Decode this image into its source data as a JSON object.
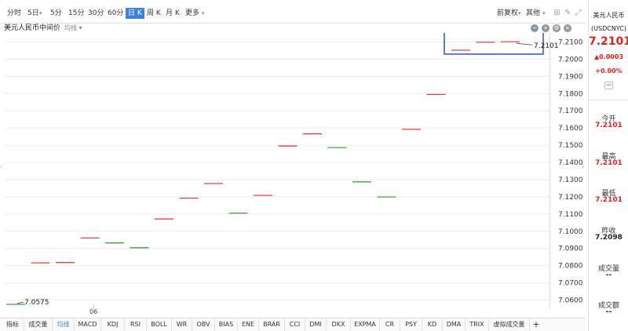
{
  "toolbar": {
    "periods": [
      "分时",
      "5日",
      "5分",
      "15分",
      "30分",
      "60分",
      "日 K",
      "周 K",
      "月 K",
      "更多"
    ],
    "active_period": "日 K",
    "adjust_label": "前复权",
    "other_label": "其他",
    "icons": [
      "grid-icon",
      "draw-icon",
      "expand-icon"
    ]
  },
  "chart_header": {
    "title": "美元人民币中间价",
    "avg_label": "均线",
    "controls": [
      "zoom-out-icon",
      "zoom-in-icon",
      "settings-icon",
      "close-icon"
    ]
  },
  "chart_data": {
    "type": "candlestick",
    "title": "美元人民币中间价",
    "y_ticks": [
      "7.2100",
      "7.2000",
      "7.1900",
      "7.1800",
      "7.1700",
      "7.1600",
      "7.1500",
      "7.1400",
      "7.1300",
      "7.1200",
      "7.1100",
      "7.1000",
      "7.0900",
      "7.0800",
      "7.0700",
      "7.0600"
    ],
    "ylim": [
      7.0575,
      7.2143
    ],
    "x_label_tick": "06",
    "max_annotation": "7.2101",
    "min_annotation": "7.0575",
    "bars": [
      {
        "value": 7.0575,
        "color": "green"
      },
      {
        "value": 7.0816,
        "color": "red"
      },
      {
        "value": 7.0818,
        "color": "red"
      },
      {
        "value": 7.096,
        "color": "red"
      },
      {
        "value": 7.0932,
        "color": "green"
      },
      {
        "value": 7.0904,
        "color": "green"
      },
      {
        "value": 7.1071,
        "color": "red"
      },
      {
        "value": 7.1192,
        "color": "red"
      },
      {
        "value": 7.1277,
        "color": "red"
      },
      {
        "value": 7.1105,
        "color": "green"
      },
      {
        "value": 7.1208,
        "color": "red"
      },
      {
        "value": 7.1495,
        "color": "red"
      },
      {
        "value": 7.1566,
        "color": "red"
      },
      {
        "value": 7.1486,
        "color": "green"
      },
      {
        "value": 7.1287,
        "color": "green"
      },
      {
        "value": 7.1199,
        "color": "green"
      },
      {
        "value": 7.1592,
        "color": "red"
      },
      {
        "value": 7.1795,
        "color": "red"
      },
      {
        "value": 7.2052,
        "color": "red"
      },
      {
        "value": 7.2098,
        "color": "red"
      },
      {
        "value": 7.2101,
        "color": "red"
      }
    ],
    "highlight_box": {
      "from_index": 18,
      "to_index": 20
    },
    "colors": {
      "red": "#e8413f",
      "green": "#3aa53a",
      "grid": "#ececec",
      "box": "#2a52c9"
    }
  },
  "indicators": {
    "tabs": [
      "指标",
      "成交量",
      "均线",
      "MACD",
      "KDJ",
      "RSI",
      "BOLL",
      "WR",
      "OBV",
      "BIAS",
      "ENE",
      "BRAR",
      "CCI",
      "DMI",
      "DKX",
      "EXPMA",
      "CR",
      "PSY",
      "KD",
      "DMA",
      "TRIX",
      "虚拟成交量",
      "+"
    ],
    "active": "均线"
  },
  "panel": {
    "name": "美元人民币",
    "code": "(USDCNYC)",
    "price": "7.2101",
    "change": "▲0.0003",
    "change_pct": "+0.00%",
    "minus": "−",
    "stats": [
      {
        "label": "今开",
        "value": "7.2101",
        "tone": "red"
      },
      {
        "label": "最高",
        "value": "7.2101",
        "tone": "red"
      },
      {
        "label": "最低",
        "value": "7.2101",
        "tone": "red"
      },
      {
        "label": "昨收",
        "value": "7.2098",
        "tone": "dark"
      },
      {
        "label": "成交量",
        "value": "--",
        "tone": "dark"
      },
      {
        "label": "成交额",
        "value": "--",
        "tone": "dark"
      }
    ]
  }
}
